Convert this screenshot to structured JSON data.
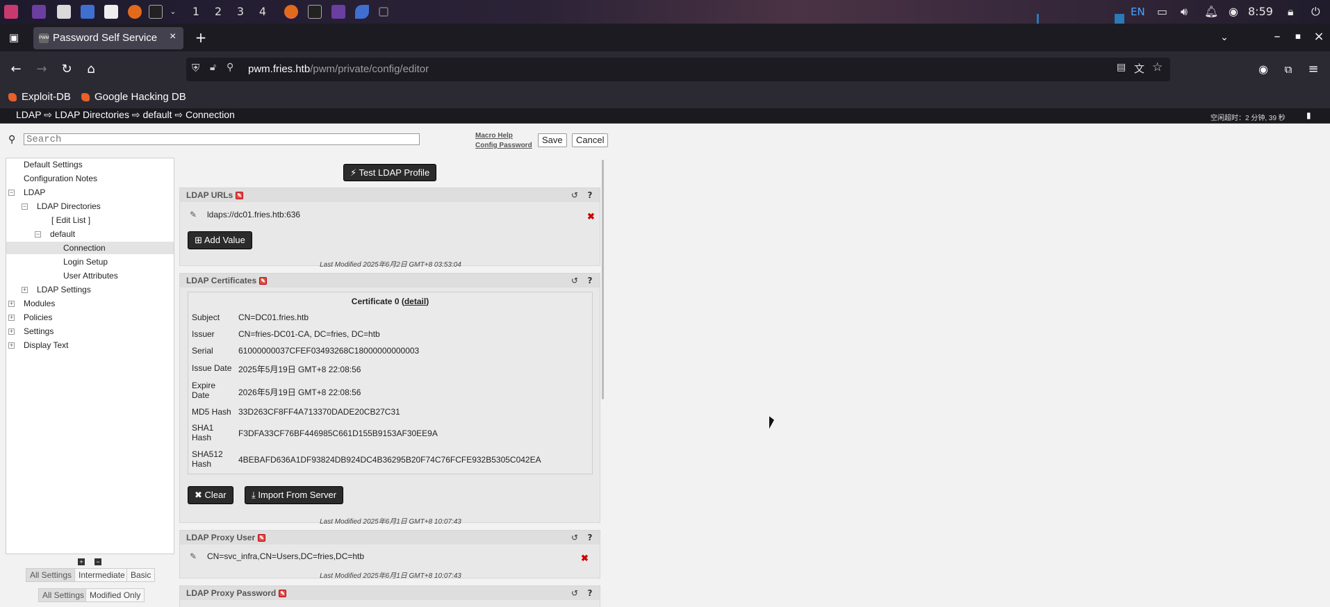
{
  "taskbar": {
    "workspaces": [
      "1",
      "2",
      "3",
      "4"
    ],
    "lang": "EN",
    "clock": "8:59"
  },
  "browser": {
    "tab_title": "Password Self Service",
    "url_host": "pwm.fries.htb",
    "url_path": "/pwm/private/config/editor",
    "bookmarks": [
      "Exploit-DB",
      "Google Hacking DB"
    ]
  },
  "pwm": {
    "breadcrumb": "LDAP ⇨ LDAP Directories ⇨ default ⇨ Connection",
    "idle_timeout": "空闲超时：2 分钟, 39 秒",
    "search_placeholder": "Search",
    "macro_help": "Macro Help",
    "config_password": "Config Password",
    "save": "Save",
    "cancel": "Cancel"
  },
  "tree": {
    "items": [
      "Default Settings",
      "Configuration Notes",
      "LDAP",
      "LDAP Directories",
      "[ Edit List ]",
      "default",
      "Connection",
      "Login Setup",
      "User Attributes",
      "LDAP Settings",
      "Modules",
      "Policies",
      "Settings",
      "Display Text"
    ],
    "level_all": "All Settings",
    "level_intermediate": "Intermediate",
    "level_basic": "Basic",
    "filter_all": "All Settings",
    "filter_modified": "Modified Only"
  },
  "main": {
    "test_ldap": "Test LDAP Profile",
    "ldap_urls": {
      "title": "LDAP URLs",
      "value": "ldaps://dc01.fries.htb:636",
      "add_value": "Add Value",
      "last_modified": "Last Modified 2025年6月2日 GMT+8 03:53:04"
    },
    "ldap_certs": {
      "title": "LDAP Certificates",
      "cert_title": "Certificate 0",
      "detail_link": "detail",
      "rows": [
        {
          "k": "Subject",
          "v": "CN=DC01.fries.htb"
        },
        {
          "k": "Issuer",
          "v": "CN=fries-DC01-CA, DC=fries, DC=htb"
        },
        {
          "k": "Serial",
          "v": "61000000037CFEF03493268C18000000000003"
        },
        {
          "k": "Issue Date",
          "v": "2025年5月19日 GMT+8 22:08:56"
        },
        {
          "k": "Expire Date",
          "v": "2026年5月19日 GMT+8 22:08:56"
        },
        {
          "k": "MD5 Hash",
          "v": "33D263CF8FF4A713370DADE20CB27C31"
        },
        {
          "k": "SHA1 Hash",
          "v": "F3DFA33CF76BF446985C661D155B9153AF30EE9A"
        },
        {
          "k": "SHA512 Hash",
          "v": "4BEBAFD636A1DF93824DB924DC4B36295B20F74C76FCFE932B5305C042EA"
        }
      ],
      "clear": "Clear",
      "import": "Import From Server",
      "last_modified": "Last Modified 2025年6月1日 GMT+8 10:07:43"
    },
    "proxy_user": {
      "title": "LDAP Proxy User",
      "value": "CN=svc_infra,CN=Users,DC=fries,DC=htb",
      "last_modified": "Last Modified 2025年6月1日 GMT+8 10:07:43"
    },
    "proxy_password": {
      "title": "LDAP Proxy Password"
    }
  }
}
